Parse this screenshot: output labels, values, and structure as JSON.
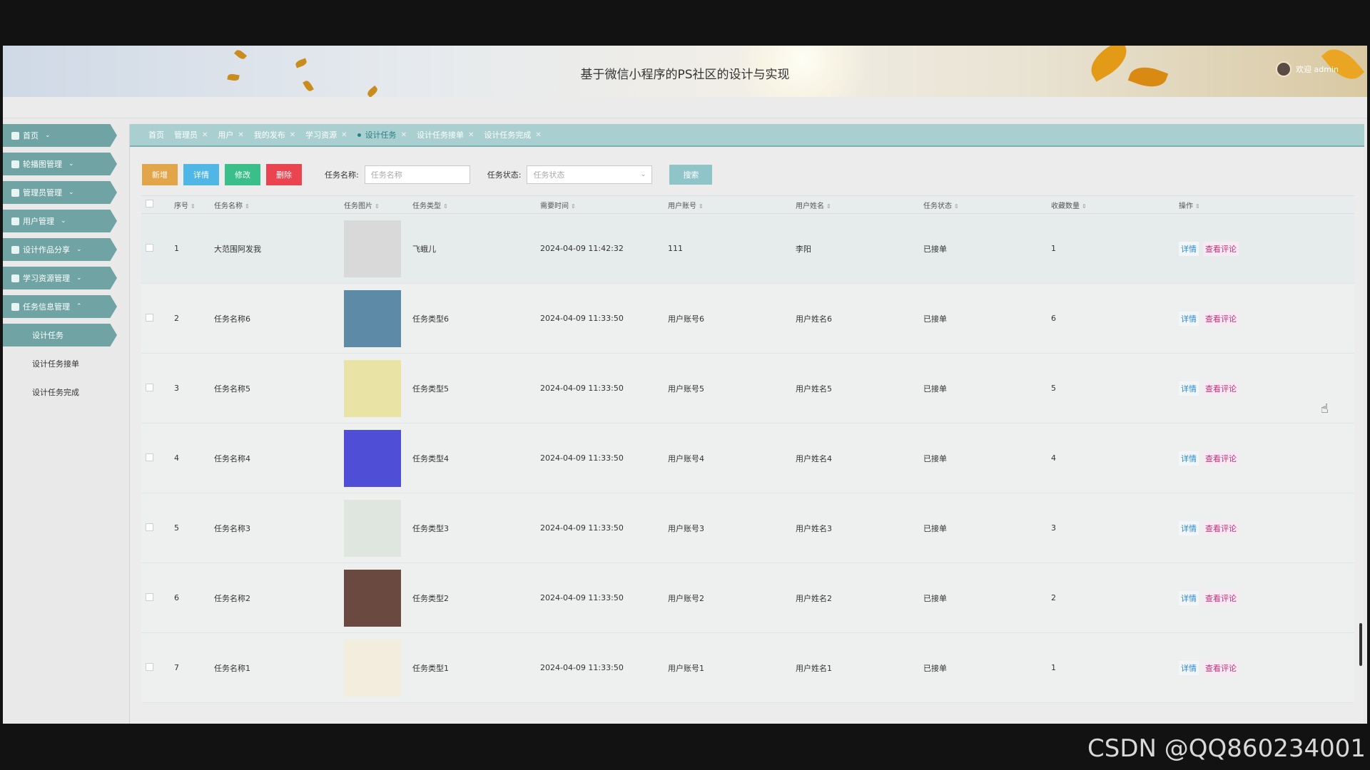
{
  "header": {
    "title": "基于微信小程序的PS社区的设计与实现",
    "user_label": "欢迎 admin"
  },
  "sidebar": {
    "items": [
      {
        "label": "首页",
        "icon": "home-icon"
      },
      {
        "label": "轮播图管理",
        "icon": "image-icon"
      },
      {
        "label": "管理员管理",
        "icon": "admin-icon"
      },
      {
        "label": "用户管理",
        "icon": "user-icon"
      },
      {
        "label": "设计作品分享",
        "icon": "grid-icon"
      },
      {
        "label": "学习资源管理",
        "icon": "gear-icon"
      },
      {
        "label": "任务信息管理",
        "icon": "mail-icon"
      }
    ],
    "subitems": [
      "设计任务",
      "设计任务接单",
      "设计任务完成"
    ]
  },
  "tabs": [
    "首页",
    "管理员",
    "用户",
    "我的发布",
    "学习资源",
    "设计任务",
    "设计任务接单",
    "设计任务完成"
  ],
  "toolbar": {
    "add": "新增",
    "detail": "详情",
    "edit": "修改",
    "delete": "删除",
    "name_label": "任务名称:",
    "name_placeholder": "任务名称",
    "status_label": "任务状态:",
    "status_placeholder": "任务状态",
    "search": "搜索"
  },
  "table": {
    "headers": [
      "序号",
      "任务名称",
      "任务图片",
      "任务类型",
      "需要时间",
      "用户账号",
      "用户姓名",
      "任务状态",
      "收藏数量",
      "操作"
    ],
    "action_detail": "详情",
    "action_comment": "查看评论",
    "rows": [
      {
        "no": "1",
        "name": "大范围阿发我",
        "type": "飞蛾儿",
        "time": "2024-04-09 11:42:32",
        "account": "111",
        "username": "李阳",
        "status": "已接单",
        "fav": "1"
      },
      {
        "no": "2",
        "name": "任务名称6",
        "type": "任务类型6",
        "time": "2024-04-09 11:33:50",
        "account": "用户账号6",
        "username": "用户姓名6",
        "status": "已接单",
        "fav": "6"
      },
      {
        "no": "3",
        "name": "任务名称5",
        "type": "任务类型5",
        "time": "2024-04-09 11:33:50",
        "account": "用户账号5",
        "username": "用户姓名5",
        "status": "已接单",
        "fav": "5"
      },
      {
        "no": "4",
        "name": "任务名称4",
        "type": "任务类型4",
        "time": "2024-04-09 11:33:50",
        "account": "用户账号4",
        "username": "用户姓名4",
        "status": "已接单",
        "fav": "4"
      },
      {
        "no": "5",
        "name": "任务名称3",
        "type": "任务类型3",
        "time": "2024-04-09 11:33:50",
        "account": "用户账号3",
        "username": "用户姓名3",
        "status": "已接单",
        "fav": "3"
      },
      {
        "no": "6",
        "name": "任务名称2",
        "type": "任务类型2",
        "time": "2024-04-09 11:33:50",
        "account": "用户账号2",
        "username": "用户姓名2",
        "status": "已接单",
        "fav": "2"
      },
      {
        "no": "7",
        "name": "任务名称1",
        "type": "任务类型1",
        "time": "2024-04-09 11:33:50",
        "account": "用户账号1",
        "username": "用户姓名1",
        "status": "已接单",
        "fav": "1"
      }
    ]
  },
  "watermark": "CSDN @QQ860234001",
  "colors": {
    "accent": "#6fa3a4",
    "tabbar": "#a9cfd0",
    "add": "#e3a54a",
    "detail": "#4fb6e6",
    "edit": "#3bbf8a",
    "delete": "#e9444f"
  }
}
